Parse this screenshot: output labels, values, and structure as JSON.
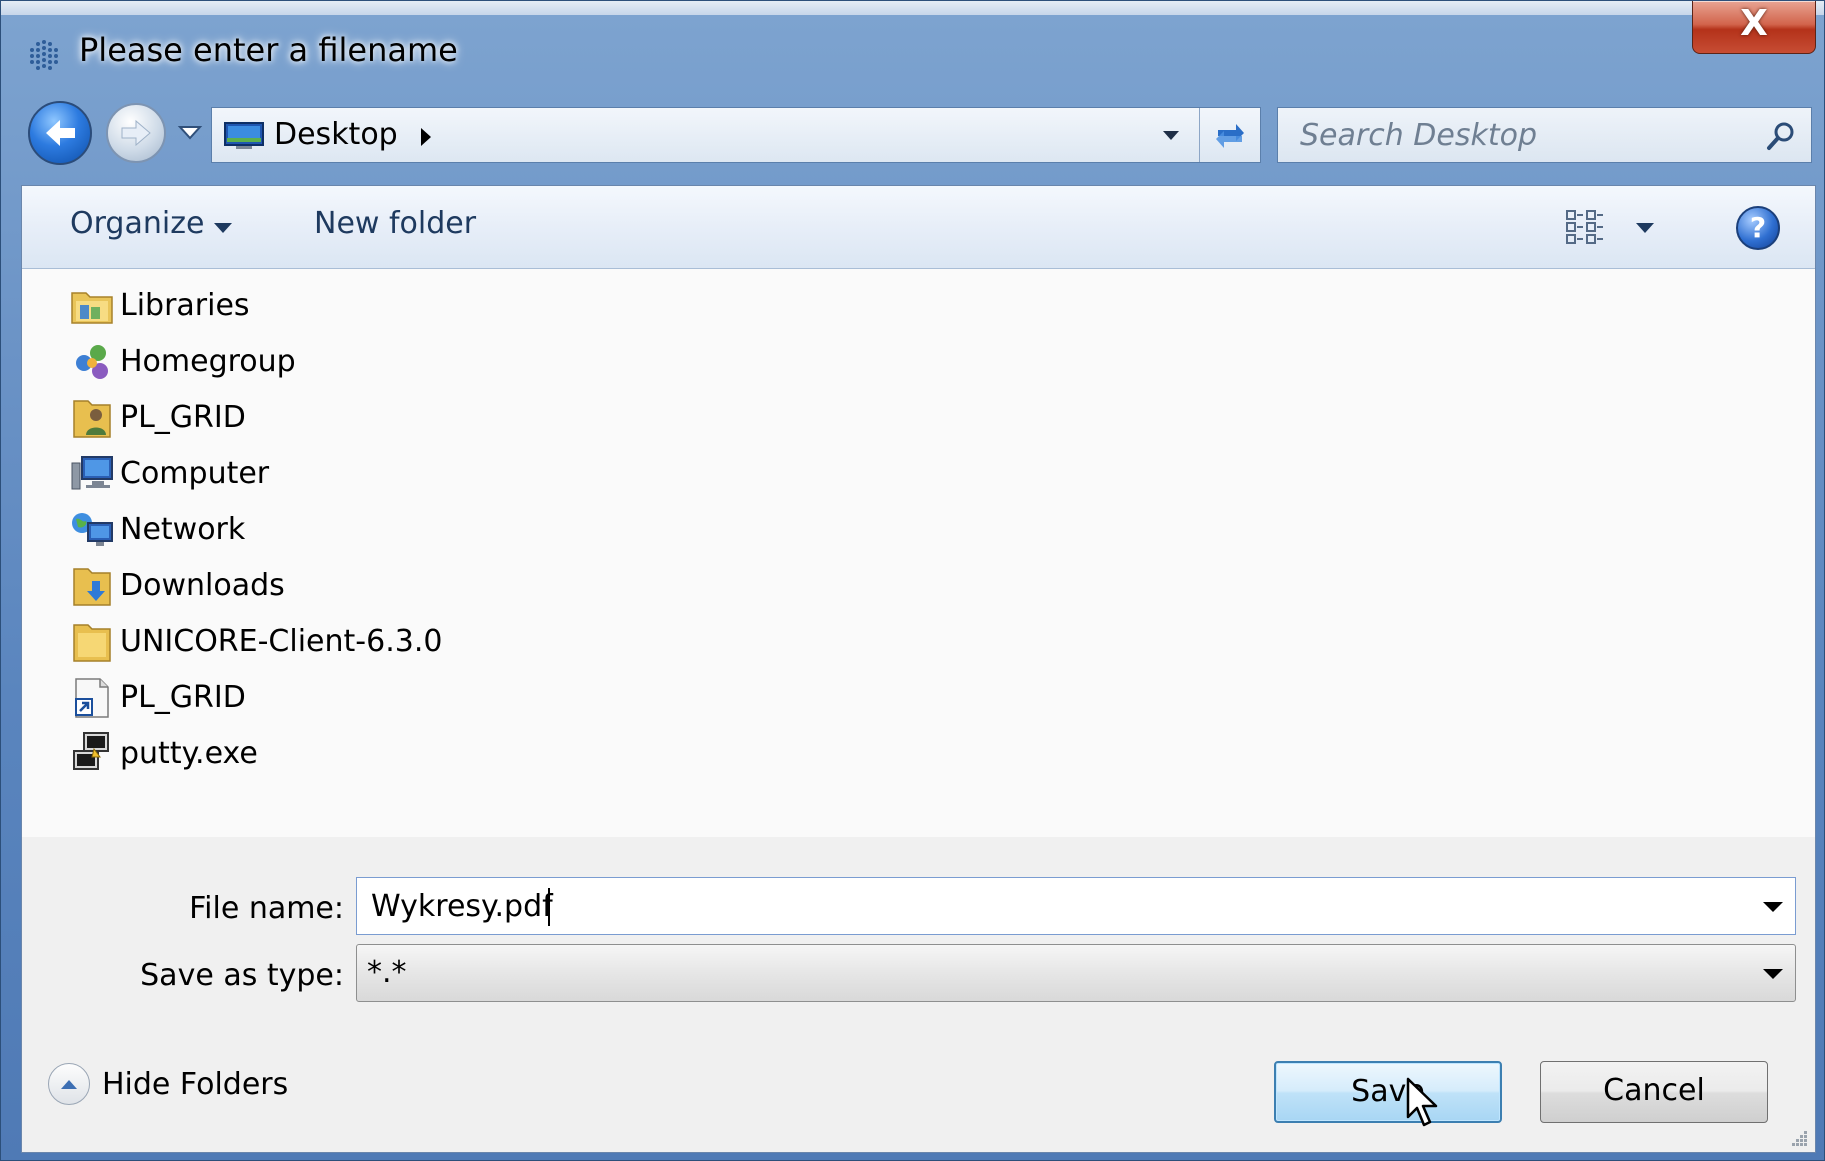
{
  "window": {
    "title": "Please enter a filename",
    "close_glyph": "X"
  },
  "navigation": {
    "address": "Desktop",
    "search_placeholder": "Search Desktop"
  },
  "toolbar": {
    "organize_label": "Organize",
    "new_folder_label": "New folder",
    "help_glyph": "?"
  },
  "items": [
    {
      "label": "Libraries",
      "icon": "libraries-icon"
    },
    {
      "label": "Homegroup",
      "icon": "homegroup-icon"
    },
    {
      "label": "PL_GRID",
      "icon": "user-folder-icon"
    },
    {
      "label": "Computer",
      "icon": "computer-icon"
    },
    {
      "label": "Network",
      "icon": "network-icon"
    },
    {
      "label": "Downloads",
      "icon": "downloads-folder-icon"
    },
    {
      "label": "UNICORE-Client-6.3.0",
      "icon": "folder-icon"
    },
    {
      "label": "PL_GRID",
      "icon": "shortcut-icon"
    },
    {
      "label": "putty.exe",
      "icon": "putty-icon"
    }
  ],
  "form": {
    "file_name_label": "File name:",
    "file_name_value": "Wykresy.pdf",
    "save_type_label": "Save as type:",
    "save_type_value": "*.*"
  },
  "footer": {
    "hide_folders_label": "Hide Folders",
    "save_label": "Save",
    "cancel_label": "Cancel"
  },
  "colors": {
    "title_gradient": "#6b93c6",
    "close_red": "#c74d34",
    "toolbar_text": "#1e3a5f",
    "default_button_border": "#3c7fb1"
  }
}
